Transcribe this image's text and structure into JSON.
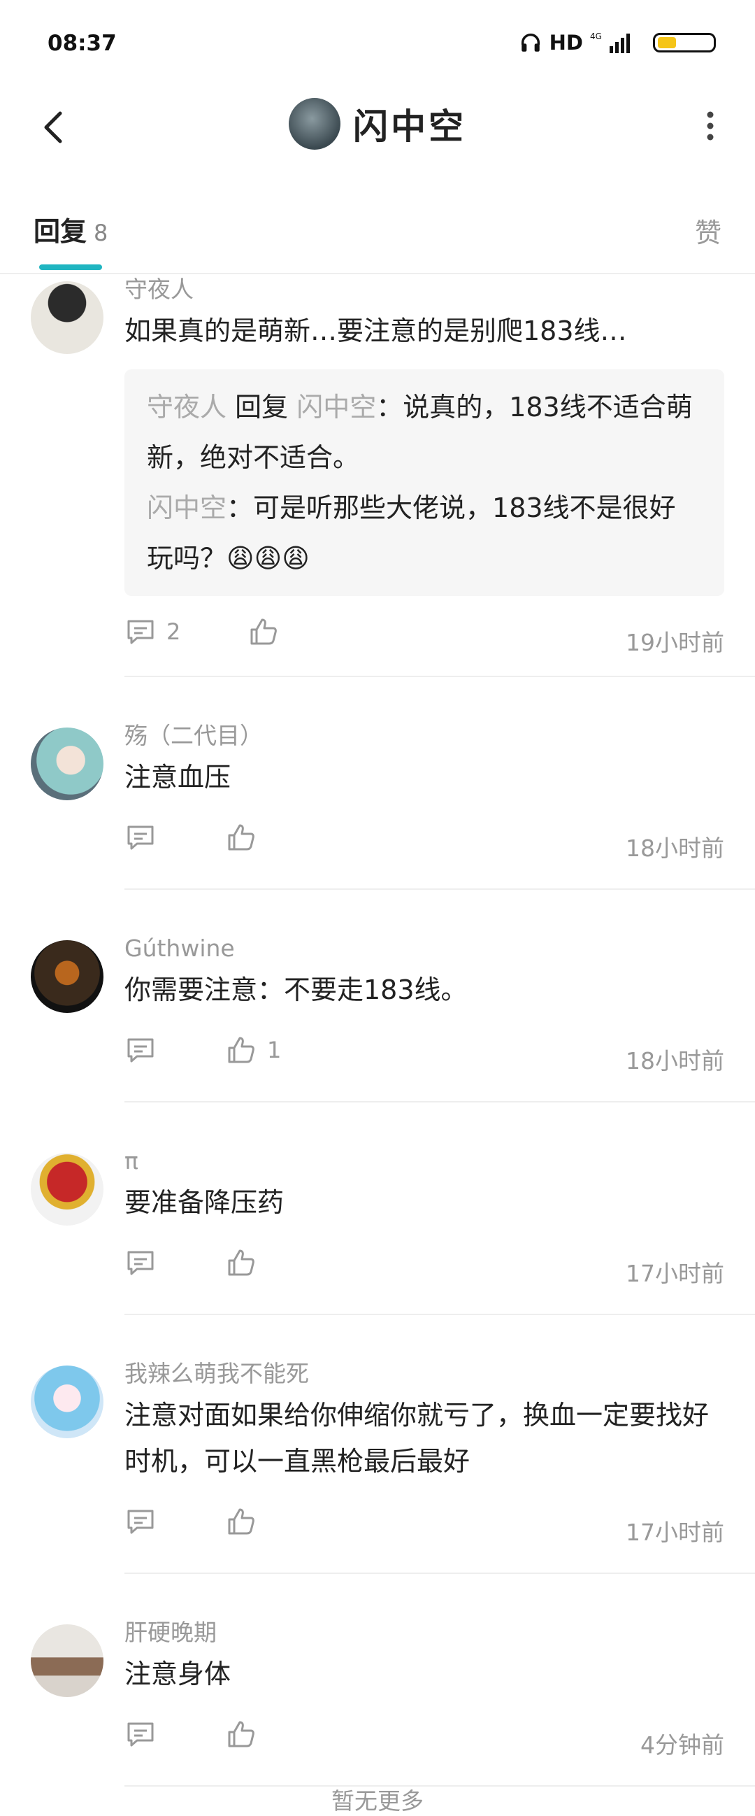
{
  "status_bar": {
    "time": "08:37",
    "network_label": "HD",
    "signal_label": "4G"
  },
  "header": {
    "title": "闪中空",
    "back_icon": "chevron-left-icon",
    "more_icon": "more-vertical-icon"
  },
  "tabs": {
    "reply_label": "回复",
    "reply_count": "8",
    "like_label": "赞"
  },
  "comments": [
    {
      "username": "守夜人",
      "text": "如果真的是萌新…要注意的是别爬183线…",
      "quote": {
        "line1_name": "守夜人",
        "line1_reply_word": " 回复 ",
        "line1_target": "闪中空",
        "line1_text": "：说真的，183线不适合萌新，绝对不适合。",
        "line2_name": "闪中空",
        "line2_text": "：可是听那些大佬说，183线不是很好玩吗？😩😩😩"
      },
      "reply_count": "2",
      "like_count": "",
      "time": "19小时前"
    },
    {
      "username": "殇（二代目）",
      "text": "注意血压",
      "reply_count": "",
      "like_count": "",
      "time": "18小时前"
    },
    {
      "username": "Gúthwine",
      "text": "你需要注意：不要走183线。",
      "reply_count": "",
      "like_count": "1",
      "time": "18小时前"
    },
    {
      "username": "π",
      "text": "要准备降压药",
      "reply_count": "",
      "like_count": "",
      "time": "17小时前"
    },
    {
      "username": "我辣么萌我不能死",
      "text": "注意对面如果给你伸缩你就亏了，换血一定要找好时机，可以一直黑枪最后最好",
      "reply_count": "",
      "like_count": "",
      "time": "17小时前"
    },
    {
      "username": "肝硬晚期",
      "text": "注意身体",
      "reply_count": "",
      "like_count": "",
      "time": "4分钟前"
    }
  ],
  "footer": {
    "text": "暂无更多"
  },
  "colors": {
    "accent": "#1fb5c1",
    "muted_text": "#999999",
    "quote_bg": "#f6f6f6"
  }
}
